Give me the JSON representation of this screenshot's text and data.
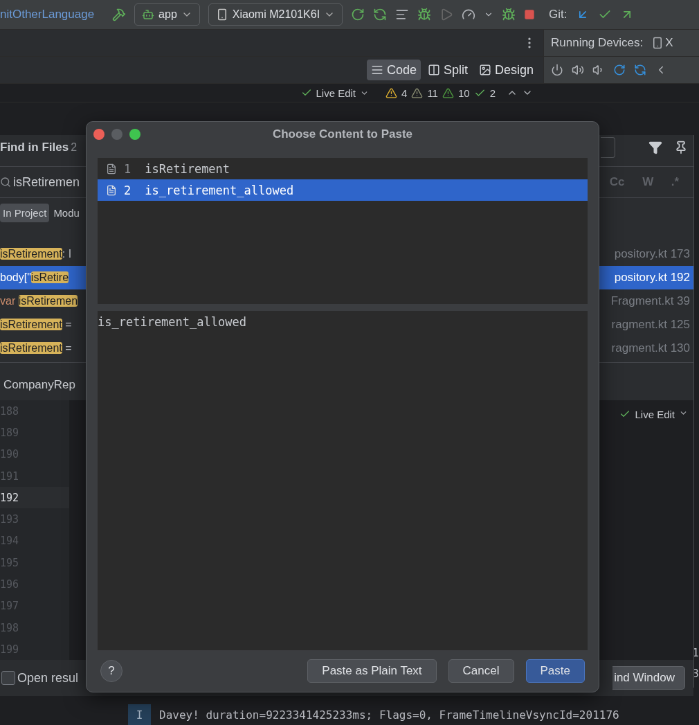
{
  "toolbar": {
    "config": "nitOtherLanguage",
    "run_config": "app",
    "device": "Xiaomi M2101K6I",
    "git_label": "Git:"
  },
  "tool_window": {
    "title": "Running Devices:",
    "device_tab": "X"
  },
  "view_modes": [
    {
      "label": "Code",
      "selected": true
    },
    {
      "label": "Split",
      "selected": false
    },
    {
      "label": "Design",
      "selected": false
    }
  ],
  "editor_status": {
    "live_edit": "Live Edit",
    "inspections": [
      {
        "kind": "warning",
        "count": "4"
      },
      {
        "kind": "weak",
        "count": "11"
      },
      {
        "kind": "typo",
        "count": "10"
      },
      {
        "kind": "ok",
        "count": "2"
      }
    ]
  },
  "find_in_files": {
    "title": "Find in Files",
    "count": "2",
    "query": "isRetiremen",
    "scopes": [
      {
        "label": "In Project",
        "selected": true
      },
      {
        "label": "Modu",
        "selected": false
      }
    ],
    "options": [
      "Cc",
      "W",
      ".*"
    ],
    "results": [
      {
        "selected": false,
        "segments": [
          {
            "kind": "match",
            "text": "isRetirement"
          },
          {
            "kind": "plain",
            "text": ": I"
          }
        ],
        "location": "pository.kt 173"
      },
      {
        "selected": true,
        "segments": [
          {
            "kind": "plain",
            "text": "body[\""
          },
          {
            "kind": "match",
            "text": "isRetire"
          }
        ],
        "location": "pository.kt 192"
      },
      {
        "selected": false,
        "segments": [
          {
            "kind": "keyword",
            "text": "var "
          },
          {
            "kind": "match",
            "text": "isRetiremen"
          }
        ],
        "location": "Fragment.kt 39"
      },
      {
        "selected": false,
        "segments": [
          {
            "kind": "match",
            "text": "isRetirement"
          },
          {
            "kind": "plain",
            "text": " ="
          }
        ],
        "location": "ragment.kt 125"
      },
      {
        "selected": false,
        "segments": [
          {
            "kind": "match",
            "text": "isRetirement"
          },
          {
            "kind": "plain",
            "text": " ="
          }
        ],
        "location": "ragment.kt 130"
      }
    ],
    "preview_tab": "CompanyRep",
    "preview_live_edit": "Live Edit",
    "line_numbers": [
      {
        "number": "188",
        "selected": false
      },
      {
        "number": "189",
        "selected": false
      },
      {
        "number": "190",
        "selected": false
      },
      {
        "number": "191",
        "selected": false
      },
      {
        "number": "192",
        "selected": true
      },
      {
        "number": "193",
        "selected": false
      },
      {
        "number": "194",
        "selected": false
      },
      {
        "number": "195",
        "selected": false
      },
      {
        "number": "196",
        "selected": false
      },
      {
        "number": "197",
        "selected": false
      },
      {
        "number": "198",
        "selected": false
      },
      {
        "number": "199",
        "selected": false
      }
    ],
    "open_results": {
      "label": "Open resul",
      "checked": false
    },
    "open_window_button": "ind Window"
  },
  "console": {
    "edge_fragments": [
      "1",
      "3"
    ],
    "lines": [
      {
        "level": "I",
        "message": "Davey! duration=9223341425233ms; Flags=0, FrameTimelineVsyncId=201176"
      }
    ]
  },
  "dialog": {
    "title": "Choose Content to Paste",
    "items": [
      {
        "index": "1",
        "text": "isRetirement",
        "selected": false
      },
      {
        "index": "2",
        "text": "is_retirement_allowed",
        "selected": true
      }
    ],
    "preview": "is_retirement_allowed",
    "help": "?",
    "buttons": [
      {
        "label": "Paste as Plain Text",
        "default": false
      },
      {
        "label": "Cancel",
        "default": false
      },
      {
        "label": "Paste",
        "default": true
      }
    ]
  }
}
